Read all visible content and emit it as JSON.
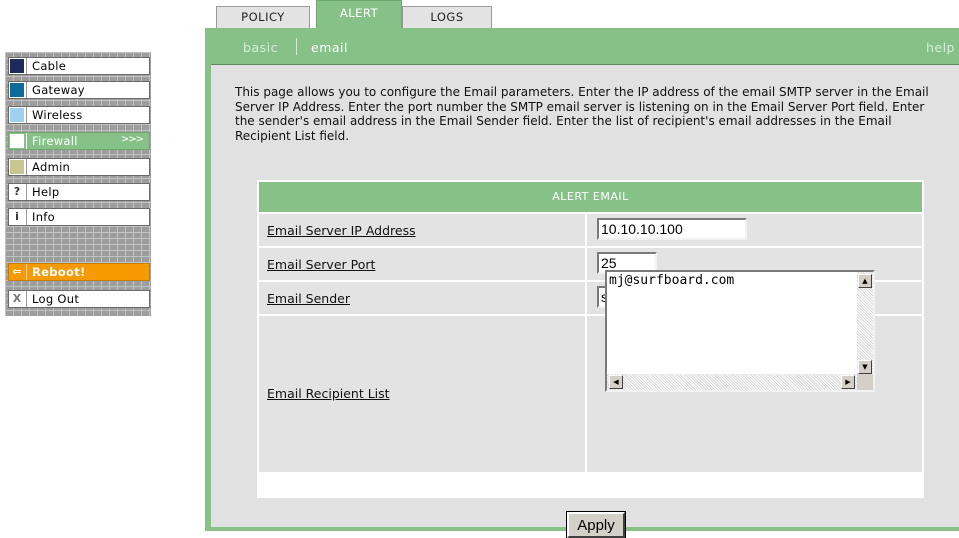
{
  "sidebar": {
    "items": [
      {
        "label": "Cable",
        "color": "#1f2a5c",
        "icon": "cable-icon"
      },
      {
        "label": "Gateway",
        "color": "#0d6b9a",
        "icon": "gateway-icon"
      },
      {
        "label": "Wireless",
        "color": "#9fd0f2",
        "icon": "wireless-icon"
      },
      {
        "label": "Firewall",
        "color": "#ffffff",
        "icon": "firewall-icon",
        "arrow": ">>>"
      },
      {
        "label": "Admin",
        "color": "#c9c78f",
        "icon": "admin-icon"
      },
      {
        "label": "Help",
        "glyph": "?",
        "icon": "help-icon"
      },
      {
        "label": "Info",
        "glyph": "i",
        "icon": "info-icon"
      }
    ],
    "reboot": {
      "label": "Reboot!",
      "glyph": "⇐",
      "icon": "reboot-icon"
    },
    "logout": {
      "label": "Log Out",
      "glyph": "X",
      "icon": "logout-icon"
    }
  },
  "tabs": [
    "POLICY",
    "ALERT",
    "LOGS"
  ],
  "subnav": {
    "basic": "basic",
    "email": "email",
    "help": "help"
  },
  "intro": "This page allows you to configure the Email parameters. Enter the IP address of the email SMTP server in the Email Server IP Address. Enter the port number the SMTP email server is listening on in the Email Server Port field. Enter the sender's email address in the Email Sender field. Enter the list of recipient's email addresses in the Email Recipient List field.",
  "form": {
    "header": "ALERT EMAIL",
    "server_ip": {
      "label": "Email Server IP Address",
      "value": "10.10.10.100"
    },
    "server_port": {
      "label": "Email Server Port",
      "value": "25"
    },
    "sender": {
      "label": "Email Sender",
      "value": "surfer@surfboard.com"
    },
    "recipients": {
      "label": "Email Recipient List",
      "value": "mj@surfboard.com"
    },
    "apply_label": "Apply"
  },
  "colors": {
    "accent_green": "#86c287",
    "reboot_orange": "#f59a00",
    "panel_gray": "#e1e1e1"
  }
}
